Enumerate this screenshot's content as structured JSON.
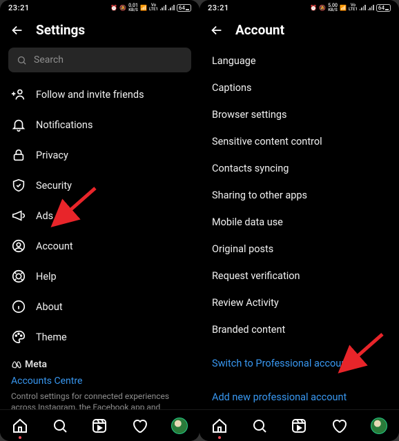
{
  "status": {
    "time": "23:21",
    "speed1": "0.01",
    "speed2": "5.00",
    "unit": "KB/S",
    "net": "Vo LTE1",
    "batt": "64"
  },
  "left": {
    "title": "Settings",
    "searchPlaceholder": "Search",
    "items": [
      {
        "label": "Follow and invite friends"
      },
      {
        "label": "Notifications"
      },
      {
        "label": "Privacy"
      },
      {
        "label": "Security"
      },
      {
        "label": "Ads"
      },
      {
        "label": "Account"
      },
      {
        "label": "Help"
      },
      {
        "label": "About"
      },
      {
        "label": "Theme"
      }
    ],
    "metaLabel": "Meta",
    "accountsCentre": "Accounts Centre",
    "metaDesc": "Control settings for connected experiences across Instagram, the Facebook app and Messenger, including story and post sharing and logging in."
  },
  "right": {
    "title": "Account",
    "items": [
      {
        "label": "Language"
      },
      {
        "label": "Captions"
      },
      {
        "label": "Browser settings"
      },
      {
        "label": "Sensitive content control"
      },
      {
        "label": "Contacts syncing"
      },
      {
        "label": "Sharing to other apps"
      },
      {
        "label": "Mobile data use"
      },
      {
        "label": "Original posts"
      },
      {
        "label": "Request verification"
      },
      {
        "label": "Review Activity"
      },
      {
        "label": "Branded content"
      }
    ],
    "switchPro": "Switch to Professional account",
    "addPro": "Add new professional account"
  }
}
